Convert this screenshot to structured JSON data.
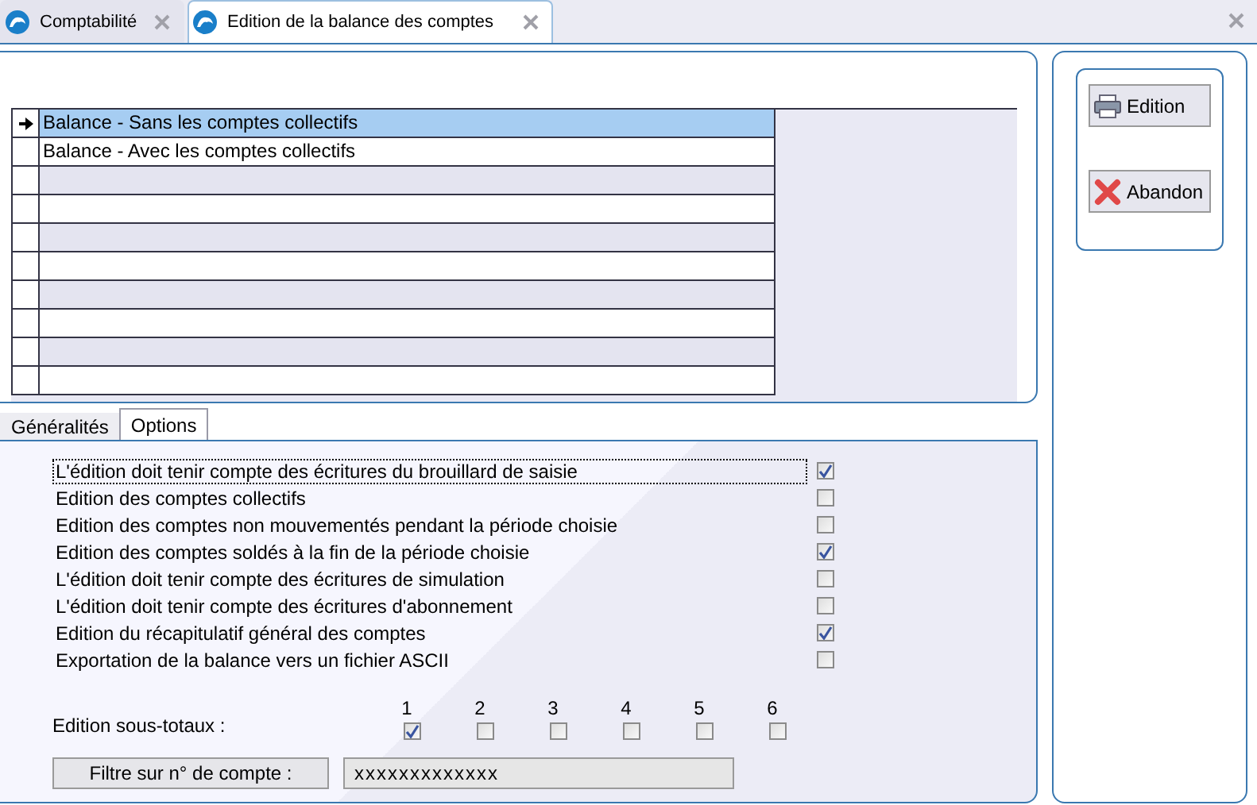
{
  "doc_tabs": [
    {
      "label": "Comptabilité",
      "selected": false
    },
    {
      "label": "Edition de la balance des comptes",
      "selected": true
    }
  ],
  "grid": {
    "rows": [
      {
        "label": "Balance - Sans les comptes collectifs",
        "selected": true
      },
      {
        "label": "Balance - Avec les comptes collectifs",
        "selected": false
      }
    ]
  },
  "section_tabs": [
    {
      "label": "Généralités",
      "selected": false
    },
    {
      "label": "Options",
      "selected": true
    }
  ],
  "options": [
    {
      "label": "L'édition doit tenir compte des écritures du brouillard de saisie",
      "checked": true,
      "focused": true
    },
    {
      "label": "Edition des comptes collectifs",
      "checked": false,
      "focused": false
    },
    {
      "label": "Edition des comptes non mouvementés pendant la période choisie",
      "checked": false,
      "focused": false
    },
    {
      "label": "Edition des comptes soldés à la fin de la période choisie",
      "checked": true,
      "focused": false
    },
    {
      "label": "L'édition doit tenir compte des écritures de simulation",
      "checked": false,
      "focused": false
    },
    {
      "label": "L'édition doit tenir compte des écritures d'abonnement",
      "checked": false,
      "focused": false
    },
    {
      "label": "Edition du récapitulatif général des comptes",
      "checked": true,
      "focused": false
    },
    {
      "label": "Exportation de la balance vers un fichier ASCII",
      "checked": false,
      "focused": false
    }
  ],
  "subtotals": {
    "label": "Edition sous-totaux :",
    "levels": [
      {
        "label": "1",
        "checked": true
      },
      {
        "label": "2",
        "checked": false
      },
      {
        "label": "3",
        "checked": false
      },
      {
        "label": "4",
        "checked": false
      },
      {
        "label": "5",
        "checked": false
      },
      {
        "label": "6",
        "checked": false
      }
    ]
  },
  "filter": {
    "button": "Filtre sur n° de compte :",
    "value": "xxxxxxxxxxxxx"
  },
  "actions": [
    {
      "label": "Edition",
      "kind": "print"
    },
    {
      "label": "Abandon",
      "kind": "cancel"
    }
  ]
}
